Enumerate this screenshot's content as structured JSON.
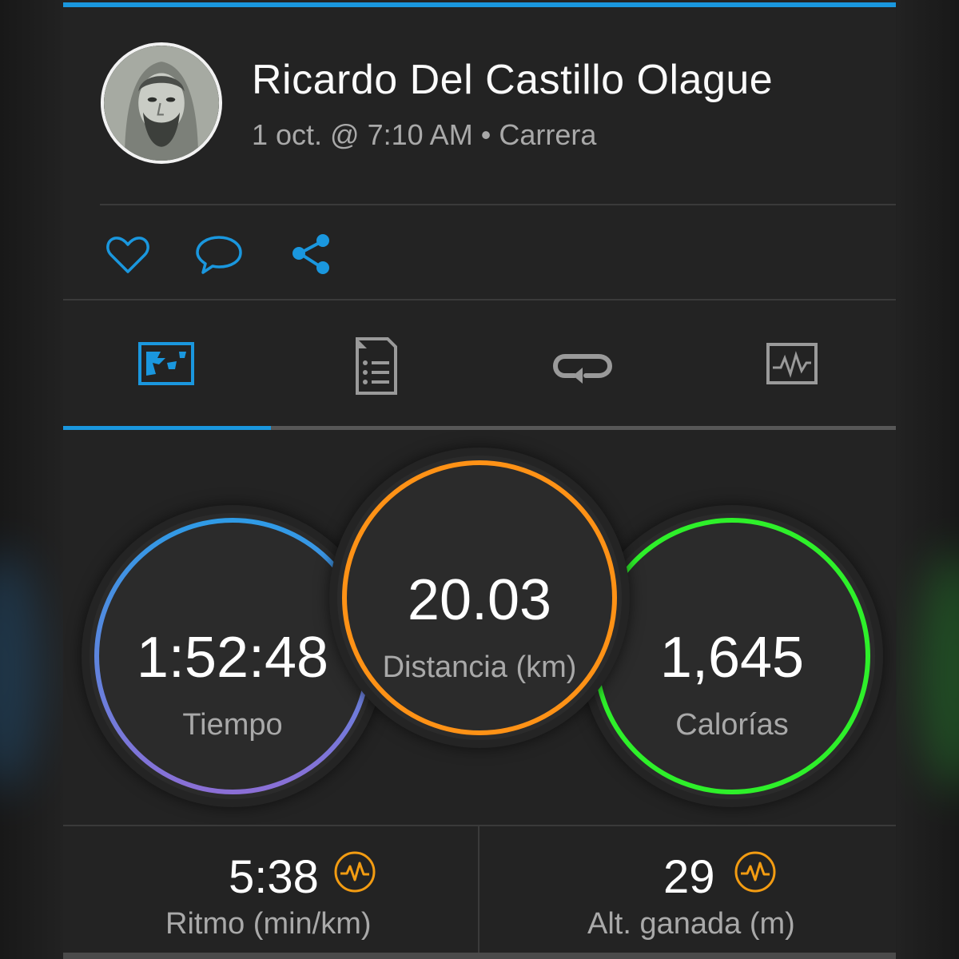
{
  "profile": {
    "name": "Ricardo Del Castillo Olague",
    "date": "1 oct. @ 7:10 AM",
    "separator": "•",
    "activity_type": "Carrera"
  },
  "actions": [
    {
      "icon": "heart-icon",
      "label": "like"
    },
    {
      "icon": "comment-icon",
      "label": "comment"
    },
    {
      "icon": "share-icon",
      "label": "share"
    }
  ],
  "tabs": [
    {
      "icon": "map-icon",
      "active": true
    },
    {
      "icon": "details-list-icon",
      "active": false
    },
    {
      "icon": "laps-icon",
      "active": false
    },
    {
      "icon": "chart-icon",
      "active": false
    }
  ],
  "stats": {
    "time": {
      "value": "1:52:48",
      "label": "Tiempo"
    },
    "distance": {
      "value": "20.03",
      "label": "Distancia (km)"
    },
    "calories": {
      "value": "1,645",
      "label": "Calorías"
    }
  },
  "summary": {
    "pace": {
      "value": "5:38",
      "label": "Ritmo (min/km)",
      "icon": "heart-rate-icon"
    },
    "elevation": {
      "value": "29",
      "label": "Alt. ganada (m)",
      "icon": "heart-rate-icon"
    }
  },
  "colors": {
    "accent": "#1a97de",
    "time_ring_top": "#2f9be6",
    "time_ring_bottom": "#8b6fd6",
    "distance_ring": "#ff9216",
    "calories_ring": "#2ef02a",
    "hr_icon": "#f39c12"
  }
}
